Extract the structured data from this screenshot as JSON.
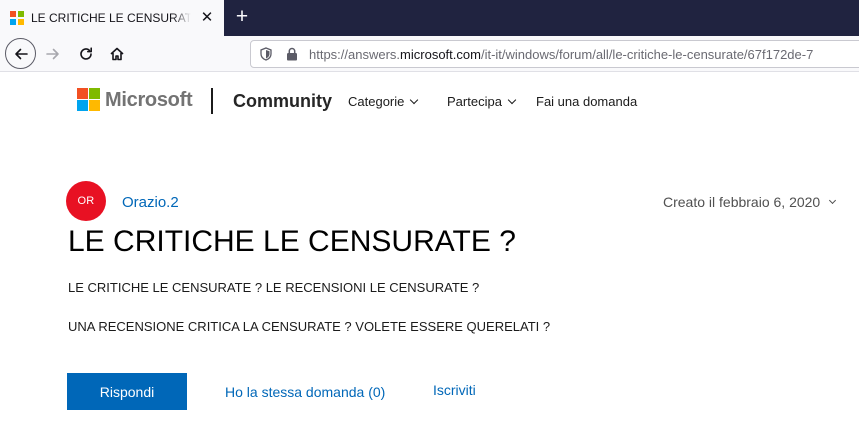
{
  "browser": {
    "tab": {
      "title": "LE CRITICHE LE CENSURATE ? -",
      "close_glyph": "✕"
    },
    "new_tab_glyph": "+",
    "url": {
      "prefix": "https://answers.",
      "host": "microsoft.com",
      "path": "/it-it/windows/forum/all/le-critiche-le-censurate/67f172de-7"
    }
  },
  "header": {
    "brand": "Microsoft",
    "section": "Community",
    "nav": [
      {
        "label": "Categorie"
      },
      {
        "label": "Partecipa"
      },
      {
        "label": "Fai una domanda"
      }
    ]
  },
  "question": {
    "avatar_initials": "OR",
    "author": "Orazio.2",
    "created": "Creato il febbraio 6, 2020",
    "title": "LE CRITICHE LE CENSURATE ?",
    "body": [
      "LE CRITICHE LE CENSURATE ? LE RECENSIONI LE CENSURATE ?",
      "UNA RECENSIONE CRITICA LA CENSURATE ? VOLETE ESSERE QUERELATI ?"
    ],
    "actions": {
      "reply": "Rispondi",
      "same_question": "Ho la stessa domanda (0)",
      "subscribe": "Iscriviti"
    }
  },
  "colors": {
    "ms_red": "#f25022",
    "ms_green": "#7fba00",
    "ms_blue": "#00a4ef",
    "ms_yellow": "#ffb900",
    "link_blue": "#0067b8",
    "avatar_red": "#e81123",
    "tabbar_bg": "#202340"
  }
}
